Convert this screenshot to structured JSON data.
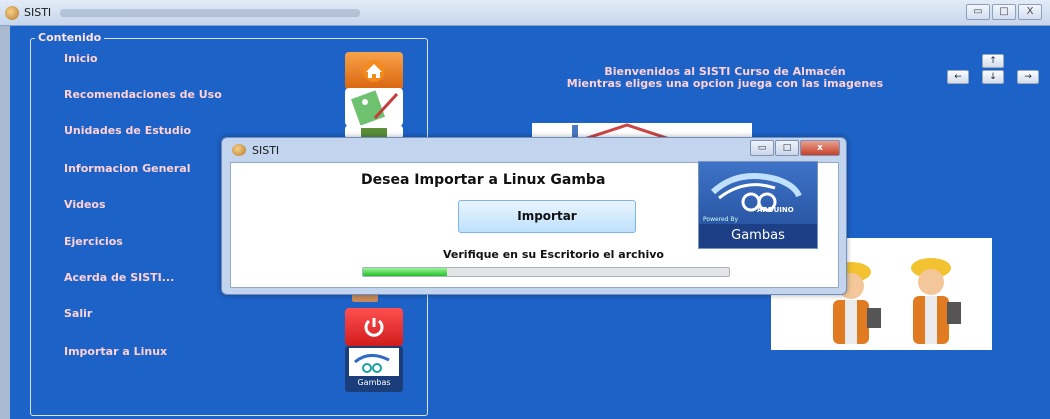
{
  "window": {
    "title": "SISTI",
    "buttons": {
      "minimize": "▭",
      "maximize": "□",
      "close": "X"
    }
  },
  "group": {
    "legend": "Contenido"
  },
  "menu": [
    {
      "label": "Inicio"
    },
    {
      "label": "Recomendaciones de Uso"
    },
    {
      "label": "Unidades de Estudio"
    },
    {
      "label": "Informacion General"
    },
    {
      "label": "Videos"
    },
    {
      "label": "Ejercicios"
    },
    {
      "label": "Acerda de SISTI..."
    },
    {
      "label": "Salir"
    },
    {
      "label": "Importar a Linux"
    }
  ],
  "welcome": {
    "line1": "Bienvenidos al SISTI Curso de Almacén",
    "line2": "Mientras eliges una opcion juega con las imagenes"
  },
  "arrows": {
    "up": "↑",
    "left": "←",
    "down": "↓",
    "right": "→"
  },
  "dialog": {
    "title": "SISTI",
    "heading": "Desea Importar a Linux Gamba",
    "button_label": "Importar",
    "status_text": "Verifique en su Escritorio el archivo",
    "progress": 0.23,
    "buttons": {
      "minimize": "▭",
      "maximize": "□",
      "close": "x"
    }
  },
  "logo": {
    "arduino": "ARDUINO",
    "powered": "Powered By",
    "name": "Gambas"
  },
  "side_logo": {
    "name": "Gambas"
  },
  "colors": {
    "background": "#1d62c7",
    "menu_text": "#ffd2d9",
    "progress": "#25c02a"
  }
}
